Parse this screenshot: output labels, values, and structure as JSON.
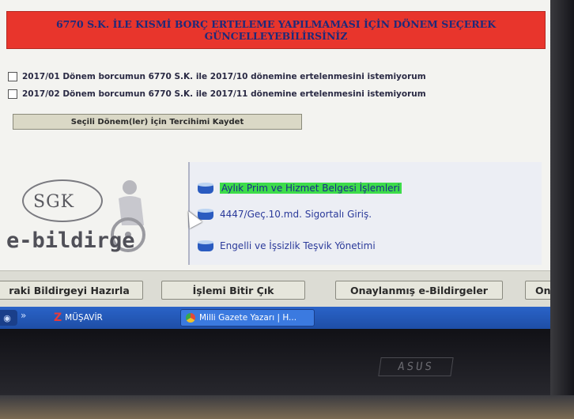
{
  "warning": {
    "text": "6770 S.K. İLE KISMİ BORÇ ERTELEME YAPILMAMASI İÇİN DÖNEM SEÇEREK GÜNCELLEYEBİLİRSİNİZ"
  },
  "options": [
    {
      "label": "2017/01 Dönem borcumun 6770 S.K. ile 2017/10 dönemine ertelenmesini istemiyorum",
      "checked": false
    },
    {
      "label": "2017/02 Dönem borcumun 6770 S.K. ile 2017/11 dönemine ertelenmesini istemiyorum",
      "checked": false
    }
  ],
  "save_button": "Seçili Dönem(ler) İçin Tercihimi Kaydet",
  "logo": {
    "sgk": "SGK",
    "brand": "e-bildirge"
  },
  "menu": [
    {
      "label": "Aylık Prim ve Hizmet Belgesi İşlemleri",
      "highlighted": true,
      "icon": "database-icon"
    },
    {
      "label": "4447/Geç.10.md. Sigortalı Giriş.",
      "highlighted": false,
      "icon": "database-icon"
    },
    {
      "label": "Engelli ve İşsizlik Teşvik Yönetimi",
      "highlighted": false,
      "icon": "database-icon"
    }
  ],
  "bottom_buttons": [
    "raki Bildirgeyi Hazırla",
    "İşlemi Bitir Çık",
    "Onaylanmış e-Bildirgeler",
    "Onay B"
  ],
  "taskbar": {
    "quick_launch": "»",
    "items": [
      {
        "label": "MÜŞAVİR",
        "icon": "z-icon"
      },
      {
        "label": "Milli Gazete Yazarı | H...",
        "icon": "chrome-icon"
      }
    ]
  },
  "monitor_brand": "ASUS",
  "colors": {
    "warning_bg": "#e8352c",
    "warning_text": "#1e2a7a",
    "highlight": "#3ddc4a",
    "link": "#2b3a9a",
    "taskbar": "#2a63c8"
  }
}
